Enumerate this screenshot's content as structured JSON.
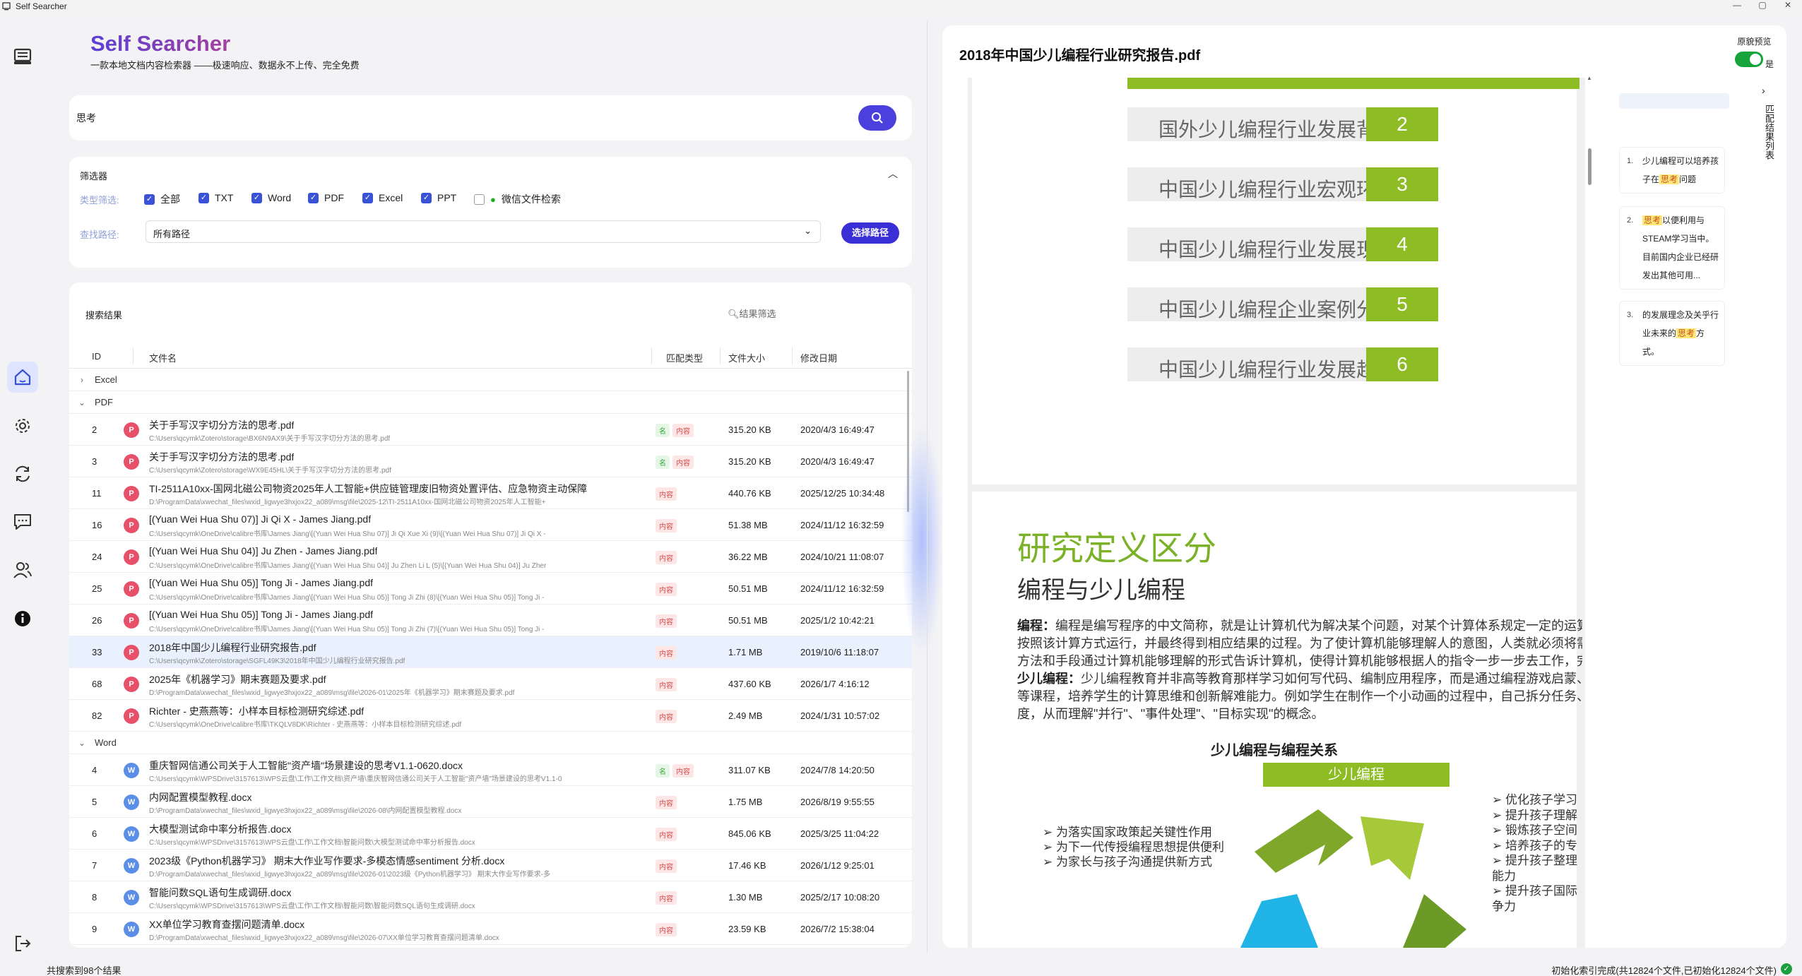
{
  "window": {
    "title": "Self Searcher",
    "controls": [
      "—",
      "▢",
      "✕"
    ]
  },
  "brand": {
    "name": "Self Searcher",
    "slogan": "一款本地文档内容检索器 ——极速响应、数据永不上传、完全免费"
  },
  "search": {
    "value": "思考"
  },
  "filter": {
    "title": "筛选器",
    "type_label": "类型筛选:",
    "types": [
      {
        "label": "全部",
        "checked": true
      },
      {
        "label": "TXT",
        "checked": true
      },
      {
        "label": "Word",
        "checked": true
      },
      {
        "label": "PDF",
        "checked": true
      },
      {
        "label": "Excel",
        "checked": true
      },
      {
        "label": "PPT",
        "checked": true
      },
      {
        "label": "微信文件检索",
        "checked": false
      }
    ],
    "path_label": "查找路径:",
    "path_value": "所有路径",
    "path_button": "选择路径"
  },
  "results": {
    "title": "搜索结果",
    "filter_placeholder": "结果筛选",
    "columns": {
      "id": "ID",
      "name": "文件名",
      "match": "匹配类型",
      "size": "文件大小",
      "date": "修改日期"
    },
    "groups": [
      {
        "name": "Excel",
        "expanded": false,
        "rows": []
      },
      {
        "name": "PDF",
        "expanded": true,
        "avatar": "P",
        "color": "#e8506a",
        "rows": [
          {
            "id": "2",
            "name": "关于手写汉字切分方法的思考.pdf",
            "path": "C:\\Users\\qcymk\\Zotero\\storage\\BX6N9AX9\\关于手写汉字切分方法的思考.pdf",
            "tags": [
              "名",
              "内容"
            ],
            "size": "315.20 KB",
            "date": "2020/4/3 16:49:47"
          },
          {
            "id": "3",
            "name": "关于手写汉字切分方法的思考.pdf",
            "path": "C:\\Users\\qcymk\\Zotero\\storage\\WX9E45HL\\关于手写汉字切分方法的思考.pdf",
            "tags": [
              "名",
              "内容"
            ],
            "size": "315.20 KB",
            "date": "2020/4/3 16:49:47"
          },
          {
            "id": "11",
            "name": "TI-2511A10xx-国网北磁公司物资2025年人工智能+供应链管理废旧物资处置评估、应急物资主动保障",
            "path": "D:\\ProgramData\\xwechat_files\\wxid_ligwye3hxjox22_a089\\msg\\file\\2025-12\\TI-2511A10xx-国网北磁公司物资2025年人工智能+",
            "tags": [
              "内容"
            ],
            "size": "440.76 KB",
            "date": "2025/12/25 10:34:48"
          },
          {
            "id": "16",
            "name": "[(Yuan Wei Hua Shu 07)] Ji Qi X - James Jiang.pdf",
            "path": "C:\\Users\\qcymk\\OneDrive\\calibre书库\\James Jiang\\[(Yuan Wei Hua Shu 07)] Ji Qi Xue Xi (9)\\[(Yuan Wei Hua Shu 07)] Ji Qi X -",
            "tags": [
              "内容"
            ],
            "size": "51.38 MB",
            "date": "2024/11/12 16:32:59"
          },
          {
            "id": "24",
            "name": "[(Yuan Wei Hua Shu 04)] Ju Zhen - James Jiang.pdf",
            "path": "C:\\Users\\qcymk\\OneDrive\\calibre书库\\James Jiang\\[(Yuan Wei Hua Shu 04)] Ju Zhen Li L (5)\\[(Yuan Wei Hua Shu 04)] Ju Zher",
            "tags": [
              "内容"
            ],
            "size": "36.22 MB",
            "date": "2024/10/21 11:08:07"
          },
          {
            "id": "25",
            "name": "[(Yuan Wei Hua Shu 05)] Tong Ji - James Jiang.pdf",
            "path": "C:\\Users\\qcymk\\OneDrive\\calibre书库\\James Jiang\\[(Yuan Wei Hua Shu 05)] Tong Ji Zhi (8)\\[(Yuan Wei Hua Shu 05)] Tong Ji -",
            "tags": [
              "内容"
            ],
            "size": "50.51 MB",
            "date": "2024/11/12 16:32:59"
          },
          {
            "id": "26",
            "name": "[(Yuan Wei Hua Shu 05)] Tong Ji - James Jiang.pdf",
            "path": "C:\\Users\\qcymk\\OneDrive\\calibre书库\\James Jiang\\[(Yuan Wei Hua Shu 05)] Tong Ji Zhi (7)\\[(Yuan Wei Hua Shu 05)] Tong Ji -",
            "tags": [
              "内容"
            ],
            "size": "50.51 MB",
            "date": "2025/1/2 10:42:21"
          },
          {
            "id": "33",
            "name": "2018年中国少儿编程行业研究报告.pdf",
            "path": "C:\\Users\\qcymk\\Zotero\\storage\\SGFL49K3\\2018年中国少儿编程行业研究报告.pdf",
            "tags": [
              "内容"
            ],
            "size": "1.71 MB",
            "date": "2019/10/6 11:18:07",
            "selected": true
          },
          {
            "id": "68",
            "name": "2025年《机器学习》期末赛题及要求.pdf",
            "path": "D:\\ProgramData\\xwechat_files\\wxid_ligwye3hxjox22_a089\\msg\\file\\2026-01\\2025年《机器学习》期末赛题及要求.pdf",
            "tags": [
              "内容"
            ],
            "size": "437.60 KB",
            "date": "2026/1/7 4:16:12"
          },
          {
            "id": "82",
            "name": "Richter - 史燕燕等：小样本目标检测研究综述.pdf",
            "path": "C:\\Users\\qcymk\\OneDrive\\calibre书库\\TKQLV8DK\\Richter - 史燕燕等：小样本目标检测研究综述.pdf",
            "tags": [
              "内容"
            ],
            "size": "2.49 MB",
            "date": "2024/1/31 10:57:02"
          }
        ]
      },
      {
        "name": "Word",
        "expanded": true,
        "avatar": "W",
        "color": "#5b8ee6",
        "rows": [
          {
            "id": "4",
            "name": "重庆智网信通公司关于人工智能\"资产墙\"场景建设的思考V1.1-0620.docx",
            "path": "C:\\Users\\qcymk\\WPSDrive\\3157613\\WPS云盘\\工作\\工作文档\\资产墙\\重庆智网信通公司关于人工智能\"资产墙\"场景建设的思考V1.1-0",
            "tags": [
              "名",
              "内容"
            ],
            "size": "311.07 KB",
            "date": "2024/7/8 14:20:50"
          },
          {
            "id": "5",
            "name": "内网配置模型教程.docx",
            "path": "D:\\ProgramData\\xwechat_files\\wxid_ligwye3hxjox22_a089\\msg\\file\\2026-08\\内网配置模型教程.docx",
            "tags": [
              "内容"
            ],
            "size": "1.75 MB",
            "date": "2026/8/19 9:55:55"
          },
          {
            "id": "6",
            "name": "大模型测试命中率分析报告.docx",
            "path": "C:\\Users\\qcymk\\WPSDrive\\3157613\\WPS云盘\\工作\\工作文档\\智能问数\\大模型测试命中率分析报告.docx",
            "tags": [
              "内容"
            ],
            "size": "845.06 KB",
            "date": "2025/3/25 11:04:22"
          },
          {
            "id": "7",
            "name": "2023级《Python机器学习》 期末大作业写作要求-多模态情感sentiment 分析.docx",
            "path": "D:\\ProgramData\\xwechat_files\\wxid_ligwye3hxjox22_a089\\msg\\file\\2026-01\\2023级《Python机器学习》 期末大作业写作要求-多",
            "tags": [
              "内容"
            ],
            "size": "17.46 KB",
            "date": "2026/1/12 9:25:01"
          },
          {
            "id": "8",
            "name": "智能问数SQL语句生成调研.docx",
            "path": "C:\\Users\\qcymk\\WPSDrive\\3157613\\WPS云盘\\工作\\工作文档\\智能问数\\智能问数SQL语句生成调研.docx",
            "tags": [
              "内容"
            ],
            "size": "1.30 MB",
            "date": "2025/2/17 10:08:20"
          },
          {
            "id": "9",
            "name": "XX单位学习教育查摆问题清单.docx",
            "path": "D:\\ProgramData\\xwechat_files\\wxid_ligwye3hxjox22_a089\\msg\\file\\2026-07\\XX单位学习教育查摆问题清单.docx",
            "tags": [
              "内容"
            ],
            "size": "23.59 KB",
            "date": "2026/7/2 15:38:04"
          }
        ]
      }
    ]
  },
  "preview": {
    "title": "2018年中国少儿编程行业研究报告.pdf",
    "toggle_label": "原貌预览",
    "toggle_value": "是",
    "toc": [
      {
        "text": "国外少儿编程行业发展背景",
        "num": "2"
      },
      {
        "text": "中国少儿编程行业宏观环境分析",
        "num": "3"
      },
      {
        "text": "中国少儿编程行业发展现状",
        "num": "4"
      },
      {
        "text": "中国少儿编程企业案例分析",
        "num": "5"
      },
      {
        "text": "中国少儿编程行业发展趋势",
        "num": "6"
      }
    ],
    "section_title": "研究定义区分",
    "section_subtitle": "编程与少儿编程",
    "para1_term": "编程：",
    "para1": [
      "编程是编写程序的中文简称，就是让计算机代为解决某个问题，对某个计算体系规定一定的运算",
      "按照该计算方式运行，并最终得到相应结果的过程。为了使计算机能够理解人的意图，人类就必须将需",
      "方法和手段通过计算机能够理解的形式告诉计算机，使得计算机能够根据人的指令一步一步去工作，完"
    ],
    "para2_term": "少儿编程：",
    "para2": [
      "少儿编程教育并非高等教育那样学习如何写代码、编制应用程序，而是通过编程游戏启蒙、",
      "等课程，培养学生的计算思维和创新解难能力。例如学生在制作一个小动画的过程中，自己拆分任务、",
      "度，从而理解\"并行\"、\"事件处理\"、\"目标实现\"的概念。"
    ],
    "diagram_title": "少儿编程与编程关系",
    "diagram_box": "少儿编程",
    "left_points": [
      "为落实国家政策起关键性作用",
      "为下一代传授编程思想提供便利",
      "为家长与孩子沟通提供新方式"
    ],
    "right_points": [
      "优化孩子学习",
      "提升孩子理解",
      "锻炼孩子空间",
      "培养孩子的专",
      "提升孩子整理",
      "能力",
      "提升孩子国际",
      "争力"
    ]
  },
  "matches": {
    "title": "匹配结果列表",
    "items": [
      {
        "num": "1.",
        "before": "少儿编程可以培养孩子在",
        "hit": "思考",
        "after": "问题"
      },
      {
        "num": "2.",
        "before": "",
        "hit": "思考",
        "after": "以便利用与STEAM学习当中。目前国内企业已经研发出其他可用..."
      },
      {
        "num": "3.",
        "before": "的发展理念及关乎行业未来的",
        "hit": "思考",
        "after": "方式。"
      }
    ]
  },
  "status": {
    "left": "共搜索到98个结果",
    "right": "初始化索引完成(共12824个文件,已初始化12824个文件)"
  }
}
